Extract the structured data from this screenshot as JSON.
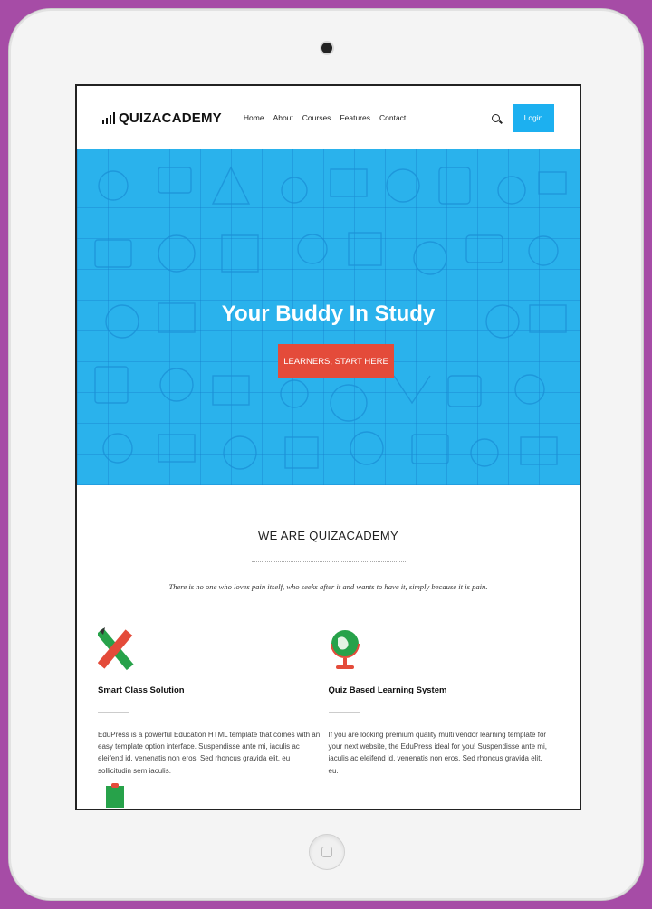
{
  "header": {
    "logo_text": "QUIZACADEMY",
    "nav": [
      "Home",
      "About",
      "Courses",
      "Features",
      "Contact"
    ],
    "login_label": "Login"
  },
  "hero": {
    "title": "Your Buddy In Study",
    "button_label": "LEARNERS, START HERE"
  },
  "about": {
    "title": "WE ARE QUIZACADEMY",
    "quote": "There is no one who loves pain itself, who seeks after it and wants to have it, simply because it is pain."
  },
  "features": [
    {
      "icon": "pencil-ruler-icon",
      "title": "Smart Class Solution",
      "text": "EduPress is a powerful Education HTML template that comes with an easy template option interface. Suspendisse ante mi, iaculis ac eleifend id, venenatis non eros. Sed rhoncus gravida elit, eu sollicitudin sem iaculis."
    },
    {
      "icon": "globe-icon",
      "title": "Quiz Based Learning System",
      "text": "If you are looking premium quality multi vendor learning template for your next website, the EduPress ideal for you! Suspendisse ante mi, iaculis ac eleifend id, venenatis non eros. Sed rhoncus gravida elit, eu."
    }
  ],
  "colors": {
    "page_background": "#a64ca6",
    "accent_blue": "#1cb0f0",
    "hero_blue": "#2ab2ec",
    "cta_red": "#e44b3a"
  }
}
